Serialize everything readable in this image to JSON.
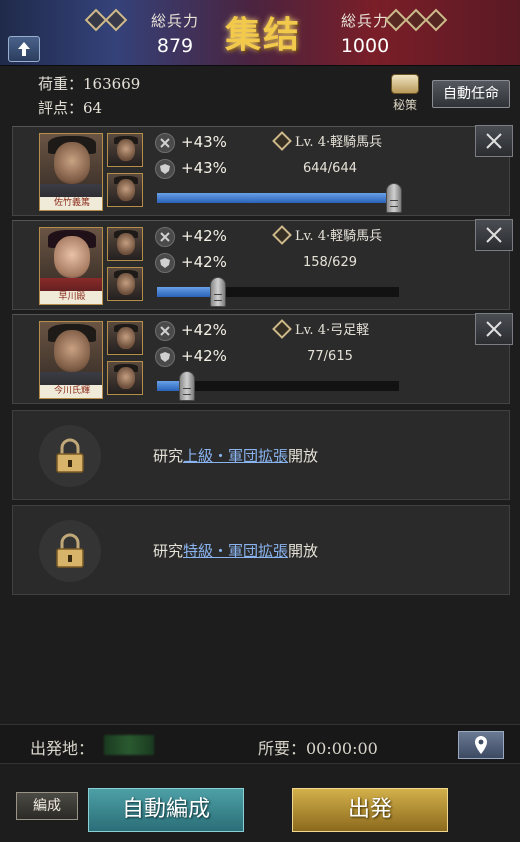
{
  "header": {
    "title": "集结",
    "left_label": "総兵力",
    "left_value": "879",
    "right_label": "総兵力",
    "right_value": "1000"
  },
  "info": {
    "weight_label": "荷重：",
    "weight_value": "163669",
    "score_label": "評点：",
    "score_value": "64",
    "secret_label": "秘策",
    "auto_assign_label": "自動任命"
  },
  "units": [
    {
      "commander_name": "佐竹義篤",
      "stat1": "+43%",
      "stat2": "+43%",
      "troop_type": "Lv. 4·軽騎馬兵",
      "count": "644/644",
      "fill_fraction": 0.98
    },
    {
      "commander_name": "早川殿",
      "stat1": "+42%",
      "stat2": "+42%",
      "troop_type": "Lv. 4·軽騎馬兵",
      "count": "158/629",
      "fill_fraction": 0.25
    },
    {
      "commander_name": "今川氏輝",
      "stat1": "+42%",
      "stat2": "+42%",
      "troop_type": "Lv. 4·弓足軽",
      "count": "77/615",
      "fill_fraction": 0.125
    }
  ],
  "locked_slots": [
    {
      "prefix": "研究",
      "link": "上級・軍団拡張",
      "suffix": "開放"
    },
    {
      "prefix": "研究",
      "link": "特級・軍団拡張",
      "suffix": "開放"
    }
  ],
  "departure": {
    "origin_label": "出発地：",
    "eta_label": "所要：00:00:00"
  },
  "buttons": {
    "edit": "編成",
    "auto_form": "自動編成",
    "depart": "出発"
  },
  "colors": {
    "bar_fill": "#3a7ad0",
    "accent_gold": "#f2c94a",
    "link_blue": "#8ab4f0"
  }
}
